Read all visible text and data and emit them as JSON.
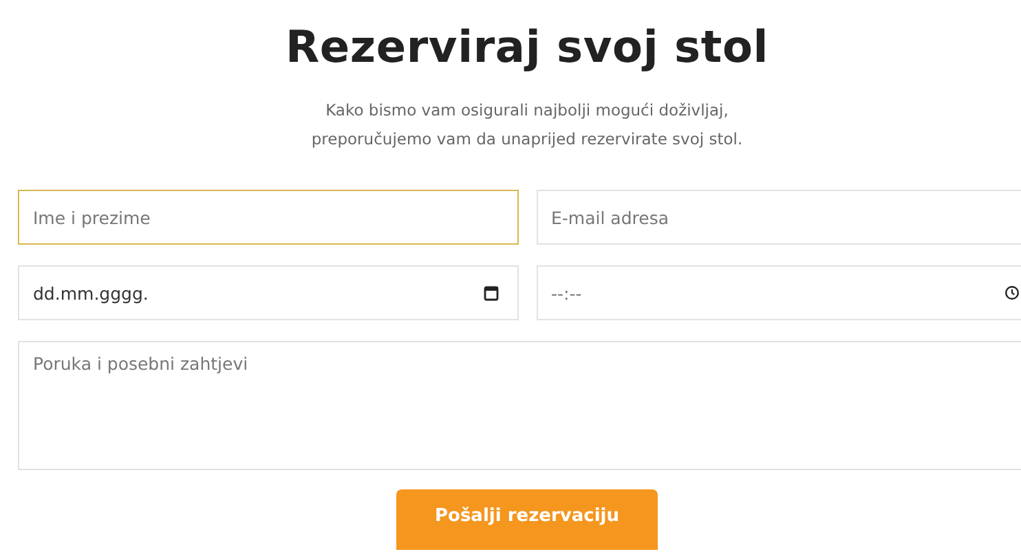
{
  "title": "Rezerviraj svoj stol",
  "intro_lines": [
    "Kako bismo vam osigurali najbolji mogući doživljaj,",
    "preporučujemo vam da unaprijed rezervirate svoj stol."
  ],
  "fields": [
    {
      "kind": "text",
      "placeholder": "Ime i prezime",
      "focused": true
    },
    {
      "kind": "text",
      "placeholder": "E-mail adresa",
      "focused": false
    },
    {
      "kind": "date",
      "placeholder": "dd.mm.gggg.",
      "focused": false
    },
    {
      "kind": "time",
      "placeholder": "--:--",
      "focused": false
    },
    {
      "kind": "textarea",
      "placeholder": "Poruka i posebni zahtjevi",
      "focused": false
    }
  ],
  "submit": "Pošalji rezervaciju"
}
